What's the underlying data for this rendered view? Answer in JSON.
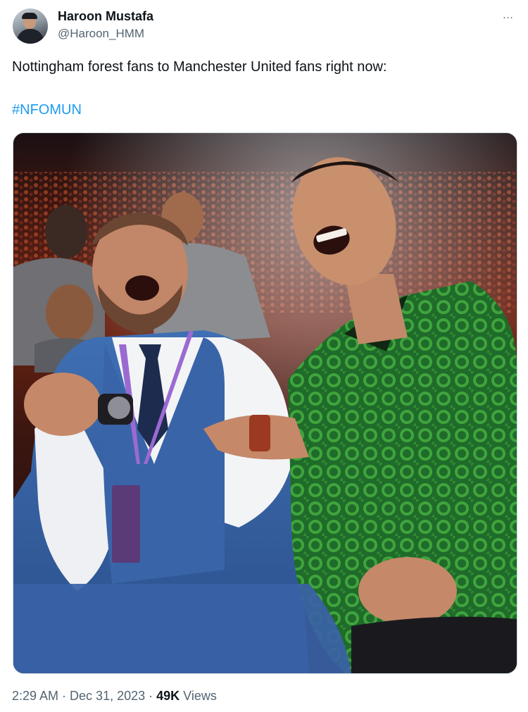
{
  "author": {
    "name": "Haroon Mustafa",
    "handle": "@Haroon_HMM"
  },
  "more_icon": "…",
  "tweet": {
    "text": "Nottingham forest fans to Manchester United fans right now:",
    "hashtag": "#NFOMUN"
  },
  "media": {
    "icon": "photo-icon"
  },
  "footer": {
    "time": "2:29 AM",
    "sep1": " · ",
    "date": "Dec 31, 2023",
    "sep2": " · ",
    "views_count": "49K",
    "views_label": " Views"
  },
  "colors": {
    "link": "#1d9bf0",
    "secondary_text": "#536471",
    "primary_text": "#0f1419",
    "border": "#cfd9de"
  }
}
